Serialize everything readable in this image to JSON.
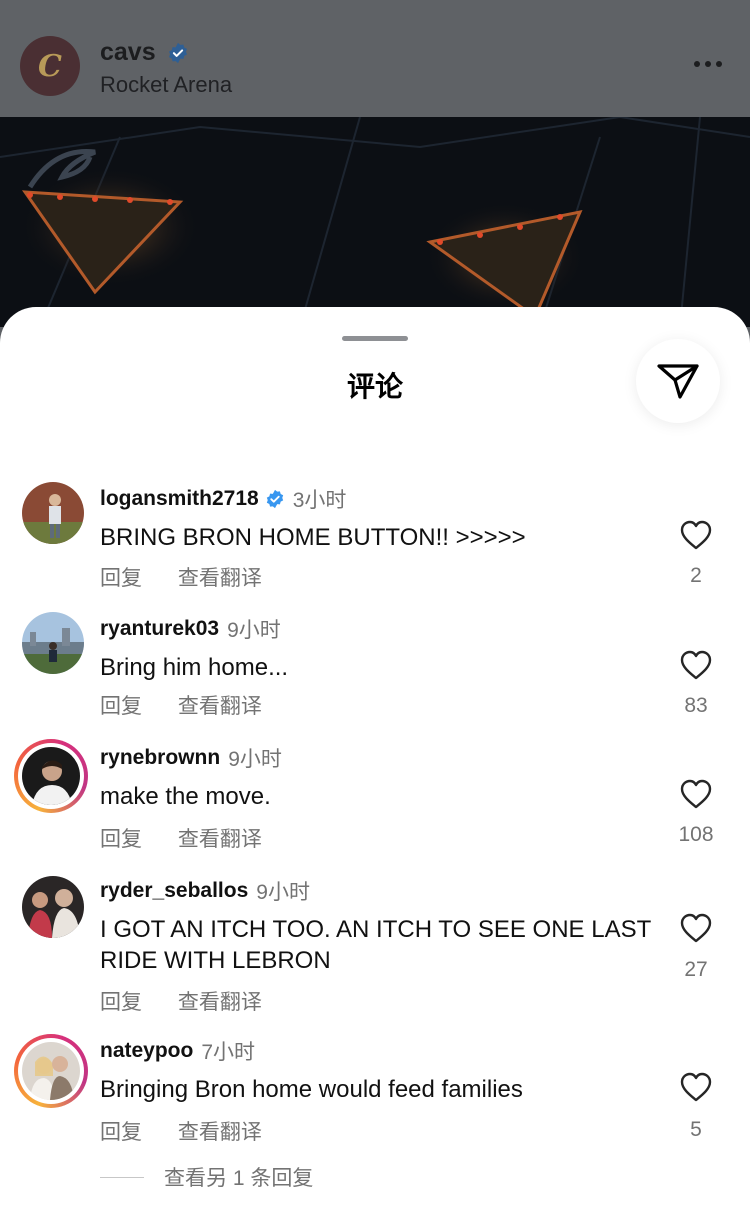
{
  "header": {
    "account_name": "cavs",
    "location": "Rocket Arena",
    "avatar_letter": "C"
  },
  "sheet": {
    "title": "评论"
  },
  "comments": [
    {
      "username": "logansmith2718",
      "verified": true,
      "time": "3小时",
      "text": "BRING BRON HOME BUTTON!! >>>>>",
      "reply_label": "回复",
      "translate_label": "查看翻译",
      "likes": "2"
    },
    {
      "username": "ryanturek03",
      "verified": false,
      "time": "9小时",
      "text": "Bring him home...",
      "reply_label": "回复",
      "translate_label": "查看翻译",
      "likes": "83"
    },
    {
      "username": "rynebrownn",
      "verified": false,
      "time": "9小时",
      "text": "make the move.",
      "reply_label": "回复",
      "translate_label": "查看翻译",
      "likes": "108"
    },
    {
      "username": "ryder_seballos",
      "verified": false,
      "time": "9小时",
      "text": "I GOT AN ITCH TOO. AN ITCH TO SEE ONE LAST RIDE WITH LEBRON",
      "reply_label": "回复",
      "translate_label": "查看翻译",
      "likes": "27"
    },
    {
      "username": "nateypoo",
      "verified": false,
      "time": "7小时",
      "text": "Bringing Bron home would feed families",
      "reply_label": "回复",
      "translate_label": "查看翻译",
      "likes": "5"
    }
  ],
  "view_more_replies": "查看另 1 条回复",
  "colors": {
    "verified_blue": "#3897f0",
    "secondary_text": "#737373",
    "story_ring": "#d6307c"
  }
}
